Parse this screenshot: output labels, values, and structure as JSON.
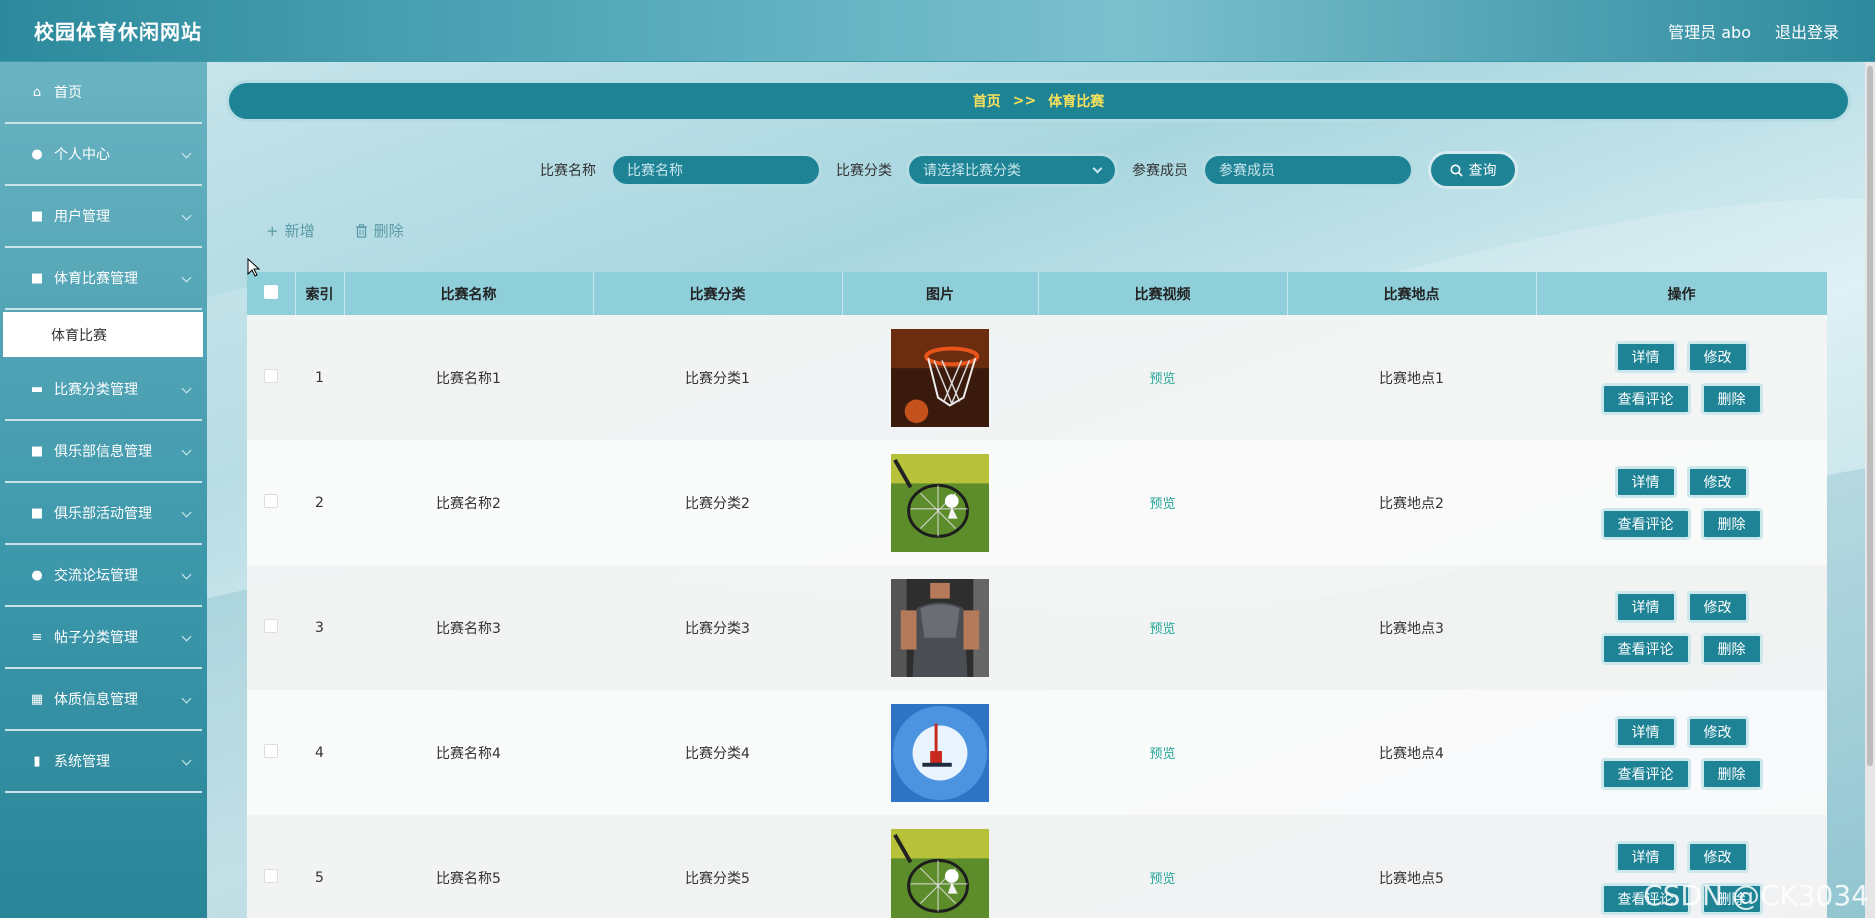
{
  "header": {
    "site_title": "校园体育休闲网站",
    "user": "管理员 abo",
    "logout": "退出登录"
  },
  "sidebar": {
    "items": [
      {
        "label": "首页",
        "icon": "home-icon",
        "glyph": "⌂",
        "chevron": false
      },
      {
        "label": "个人中心",
        "icon": "user-icon",
        "glyph": "●",
        "chevron": true
      },
      {
        "label": "用户管理",
        "icon": "grid-icon",
        "glyph": "■",
        "chevron": true
      },
      {
        "label": "体育比赛管理",
        "icon": "grid-icon",
        "glyph": "■",
        "chevron": true
      },
      {
        "label": "比赛分类管理",
        "icon": "ticket-icon",
        "glyph": "▬",
        "chevron": true
      },
      {
        "label": "俱乐部信息管理",
        "icon": "grid-icon",
        "glyph": "■",
        "chevron": true
      },
      {
        "label": "俱乐部活动管理",
        "icon": "grid-icon",
        "glyph": "■",
        "chevron": true
      },
      {
        "label": "交流论坛管理",
        "icon": "user-icon",
        "glyph": "●",
        "chevron": true
      },
      {
        "label": "帖子分类管理",
        "icon": "list-icon",
        "glyph": "≡",
        "chevron": true
      },
      {
        "label": "体质信息管理",
        "icon": "table-icon",
        "glyph": "▦",
        "chevron": true
      },
      {
        "label": "系统管理",
        "icon": "bar-chart-icon",
        "glyph": "▮",
        "chevron": true
      }
    ],
    "submenu_label": "体育比赛"
  },
  "breadcrumb": {
    "home": "首页",
    "sep": ">>",
    "current": "体育比赛"
  },
  "search": {
    "name_label": "比赛名称",
    "name_placeholder": "比赛名称",
    "category_label": "比赛分类",
    "category_placeholder": "请选择比赛分类",
    "member_label": "参赛成员",
    "member_placeholder": "参赛成员",
    "query_label": "查询"
  },
  "actions": {
    "add": "新增",
    "delete": "删除"
  },
  "table": {
    "headers": [
      "索引",
      "比赛名称",
      "比赛分类",
      "图片",
      "比赛视频",
      "比赛地点",
      "操作"
    ],
    "rows": [
      {
        "index": "1",
        "name": "比赛名称1",
        "category": "比赛分类1",
        "image": "basketball-hoop",
        "video": "预览",
        "location": "比赛地点1"
      },
      {
        "index": "2",
        "name": "比赛名称2",
        "category": "比赛分类2",
        "image": "badminton-racket",
        "video": "预览",
        "location": "比赛地点2"
      },
      {
        "index": "3",
        "name": "比赛名称3",
        "category": "比赛分类3",
        "image": "gym-athlete",
        "video": "预览",
        "location": "比赛地点3"
      },
      {
        "index": "4",
        "name": "比赛名称4",
        "category": "比赛分类4",
        "image": "bungee-sky",
        "video": "预览",
        "location": "比赛地点4"
      },
      {
        "index": "5",
        "name": "比赛名称5",
        "category": "比赛分类5",
        "image": "badminton-racket",
        "video": "预览",
        "location": "比赛地点5"
      }
    ],
    "ops": {
      "detail": "详情",
      "edit": "修改",
      "comments": "查看评论",
      "delete": "删除"
    }
  },
  "watermark": "CSDN @CK3034",
  "colors": {
    "primary": "#1f8396",
    "header_bg": "#8fcfda",
    "breadcrumb_text": "#f7e15a",
    "preview_link": "#26a69a"
  }
}
